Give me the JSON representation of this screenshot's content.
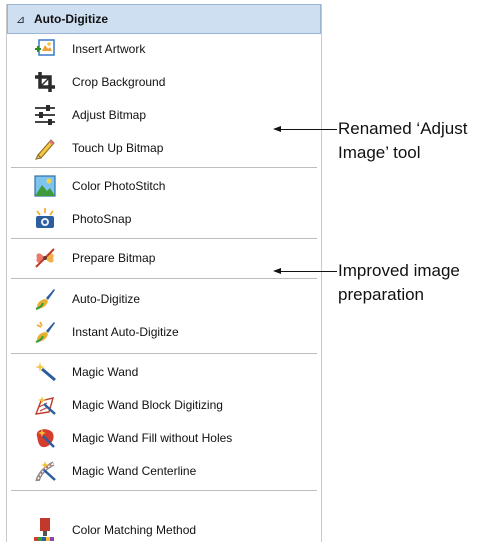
{
  "panel": {
    "header": {
      "arrow": "⊿",
      "title": "Auto-Digitize"
    },
    "groups": [
      {
        "items": [
          {
            "name": "insert-artwork",
            "label": "Insert Artwork",
            "icon": "insert-artwork-icon"
          },
          {
            "name": "crop-background",
            "label": "Crop Background",
            "icon": "crop-icon"
          },
          {
            "name": "adjust-bitmap",
            "label": "Adjust Bitmap",
            "icon": "sliders-icon"
          },
          {
            "name": "touch-up-bitmap",
            "label": "Touch Up Bitmap",
            "icon": "pencil-icon"
          }
        ]
      },
      {
        "items": [
          {
            "name": "color-photostitch",
            "label": "Color PhotoStitch",
            "icon": "landscape-photo-icon"
          },
          {
            "name": "photosnap",
            "label": "PhotoSnap",
            "icon": "camera-icon"
          }
        ]
      },
      {
        "items": [
          {
            "name": "prepare-bitmap",
            "label": "Prepare Bitmap",
            "icon": "prepare-bitmap-icon"
          }
        ]
      },
      {
        "items": [
          {
            "name": "auto-digitize",
            "label": "Auto-Digitize",
            "icon": "paintbrush-icon"
          },
          {
            "name": "instant-auto-digitize",
            "label": "Instant Auto-Digitize",
            "icon": "instant-paintbrush-icon"
          }
        ]
      },
      {
        "items": [
          {
            "name": "magic-wand",
            "label": "Magic Wand",
            "icon": "magic-wand-icon"
          },
          {
            "name": "magic-wand-block-digitizing",
            "label": "Magic Wand Block Digitizing",
            "icon": "magic-wand-block-icon"
          },
          {
            "name": "magic-wand-fill-without-holes",
            "label": "Magic Wand Fill without Holes",
            "icon": "magic-wand-fill-icon"
          },
          {
            "name": "magic-wand-centerline",
            "label": "Magic Wand Centerline",
            "icon": "magic-wand-centerline-icon"
          }
        ]
      },
      {
        "items": [
          {
            "name": "color-matching-method",
            "label": "Color Matching Method",
            "icon": "color-matching-icon"
          }
        ]
      }
    ]
  },
  "callouts": {
    "adjust": {
      "line1": "Renamed ‘Adjust",
      "line2": "Image’ tool"
    },
    "prepare": {
      "line1": "Improved image",
      "line2": "preparation"
    }
  }
}
